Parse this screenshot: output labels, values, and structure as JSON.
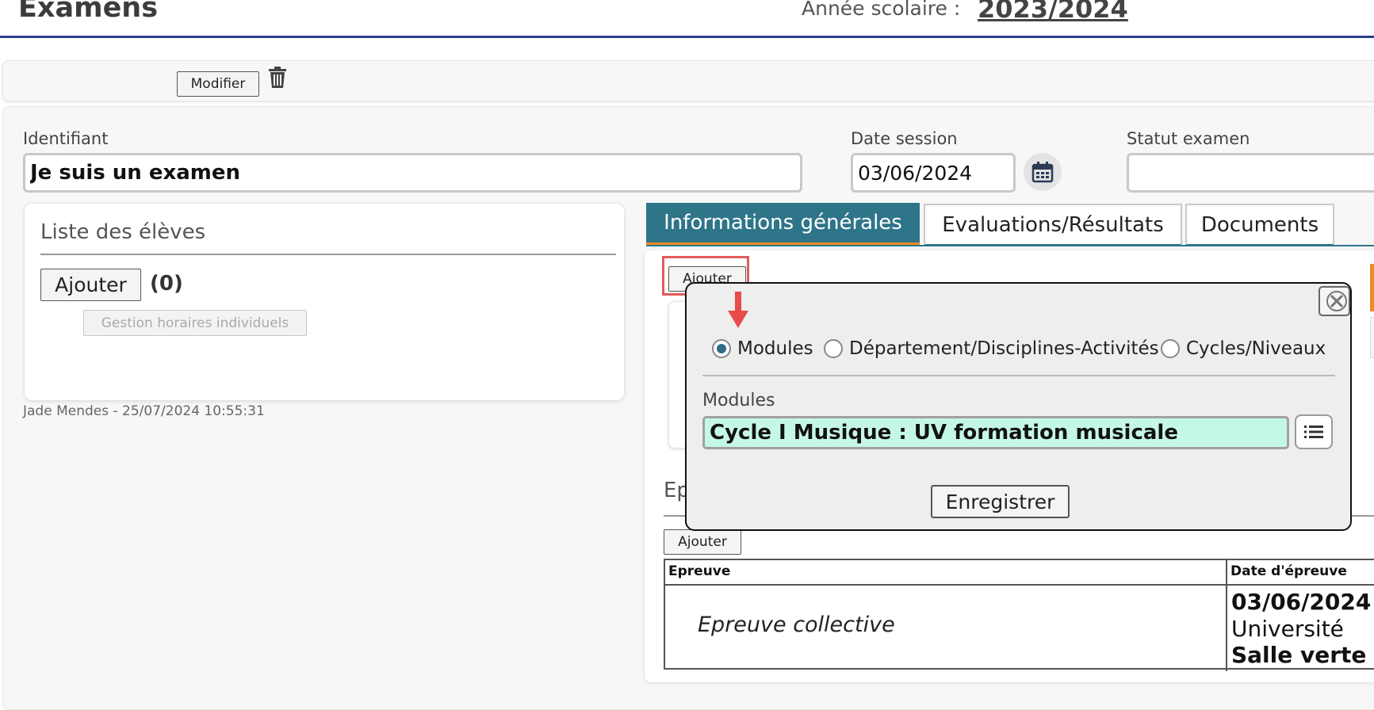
{
  "header": {
    "title": "Examens",
    "year_label": "Année scolaire :",
    "year_value": "2023/2024"
  },
  "toolbar": {
    "modify_label": "Modifier",
    "delete_icon": "trash-icon"
  },
  "form": {
    "identifiant_label": "Identifiant",
    "identifiant_value": "Je suis un examen",
    "date_label": "Date session",
    "date_value": "03/06/2024",
    "calendar_icon": "calendar-icon",
    "statut_label": "Statut examen",
    "statut_value": ""
  },
  "students": {
    "title": "Liste des élèves",
    "add_label": "Ajouter",
    "count": "(0)",
    "gestion_label": "Gestion horaires individuels",
    "audit": "Jade Mendes - 25/07/2024 10:55:31"
  },
  "tabs": [
    {
      "label": "Informations générales",
      "active": true
    },
    {
      "label": "Evaluations/Résultats",
      "active": false
    },
    {
      "label": "Documents",
      "active": false
    }
  ],
  "tab_content": {
    "add_label": "Ajouter",
    "epreuves_title": "Ep",
    "epreuves_add_label": "Ajouter",
    "table": {
      "columns": [
        "Epreuve",
        "Date d'épreuve"
      ],
      "rows": [
        {
          "epreuve": "Epreuve collective",
          "date": "03/06/2024",
          "lieu": "Université",
          "salle": "Salle verte"
        }
      ]
    }
  },
  "popup": {
    "close_icon": "close-icon",
    "radio_options": [
      {
        "label": "Modules",
        "checked": true
      },
      {
        "label": "Département/Disciplines-Activités",
        "checked": false
      },
      {
        "label": "Cycles/Niveaux",
        "checked": false
      }
    ],
    "modules_label": "Modules",
    "modules_value": "Cycle I Musique : UV formation musicale",
    "list_icon": "list-icon",
    "save_label": "Enregistrer"
  },
  "colors": {
    "accent": "#2e7589",
    "tab_underline": "#f08a24",
    "annotation": "#e15b5b",
    "modules_field_bg": "#c5f7e8",
    "header_rule": "#2c3e8c"
  }
}
